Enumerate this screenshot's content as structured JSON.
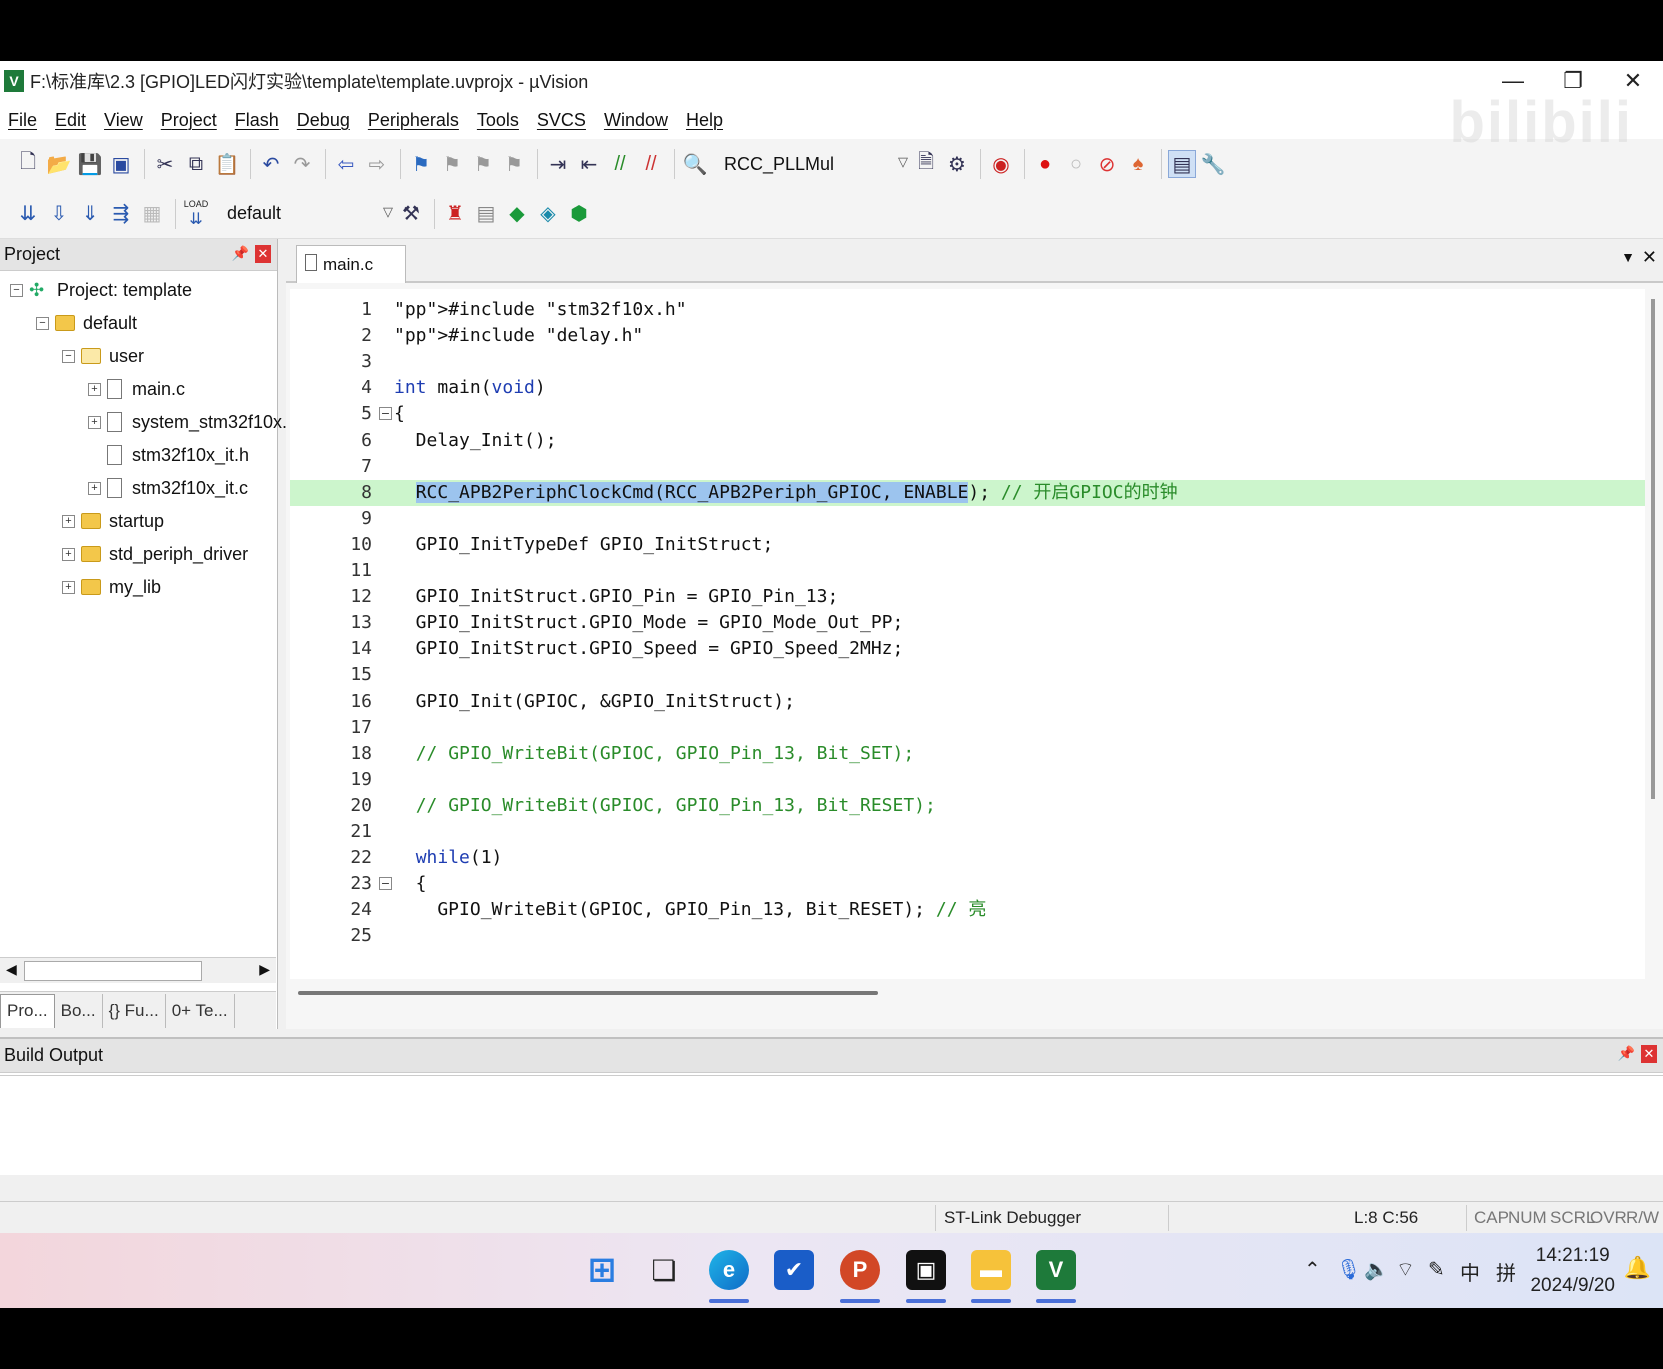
{
  "window": {
    "title": "F:\\标准库\\2.3 [GPIO]LED闪灯实验\\template\\template.uvprojx - µVision",
    "controls": {
      "minimize": "—",
      "restore": "❐",
      "close": "✕"
    }
  },
  "menu": [
    "File",
    "Edit",
    "View",
    "Project",
    "Flash",
    "Debug",
    "Peripherals",
    "Tools",
    "SVCS",
    "Window",
    "Help"
  ],
  "toolbar": {
    "find_combo_value": "RCC_PLLMul",
    "target_combo_value": "default",
    "load_label": "LOAD"
  },
  "project_panel": {
    "title": "Project",
    "tree": [
      {
        "label": "Project: template",
        "level": 0,
        "kind": "project",
        "expander": "−"
      },
      {
        "label": "default",
        "level": 1,
        "kind": "target",
        "expander": "−"
      },
      {
        "label": "user",
        "level": 2,
        "kind": "folder",
        "expander": "−"
      },
      {
        "label": "main.c",
        "level": 3,
        "kind": "file",
        "expander": "+"
      },
      {
        "label": "system_stm32f10x.c",
        "level": 3,
        "kind": "file",
        "expander": "+"
      },
      {
        "label": "stm32f10x_it.h",
        "level": 3,
        "kind": "file",
        "expander": ""
      },
      {
        "label": "stm32f10x_it.c",
        "level": 3,
        "kind": "file",
        "expander": "+"
      },
      {
        "label": "startup",
        "level": 2,
        "kind": "folder",
        "expander": "+"
      },
      {
        "label": "std_periph_driver",
        "level": 2,
        "kind": "folder",
        "expander": "+"
      },
      {
        "label": "my_lib",
        "level": 2,
        "kind": "folder",
        "expander": "+"
      }
    ],
    "tabs": [
      "Pro...",
      "Bo...",
      "{} Fu...",
      "0+ Te..."
    ]
  },
  "editor": {
    "active_tab": "main.c",
    "lines": [
      {
        "n": "1",
        "text": "#include \"stm32f10x.h\""
      },
      {
        "n": "2",
        "text": "#include \"delay.h\""
      },
      {
        "n": "3",
        "text": ""
      },
      {
        "n": "4",
        "text": "int main(void)"
      },
      {
        "n": "5",
        "text": "{"
      },
      {
        "n": "6",
        "text": "  Delay_Init();"
      },
      {
        "n": "7",
        "text": ""
      },
      {
        "n": "8",
        "text": "  RCC_APB2PeriphClockCmd(RCC_APB2Periph_GPIOC, ENABLE); // 开启GPIOC的时钟"
      },
      {
        "n": "9",
        "text": ""
      },
      {
        "n": "10",
        "text": "  GPIO_InitTypeDef GPIO_InitStruct;"
      },
      {
        "n": "11",
        "text": ""
      },
      {
        "n": "12",
        "text": "  GPIO_InitStruct.GPIO_Pin = GPIO_Pin_13;"
      },
      {
        "n": "13",
        "text": "  GPIO_InitStruct.GPIO_Mode = GPIO_Mode_Out_PP;"
      },
      {
        "n": "14",
        "text": "  GPIO_InitStruct.GPIO_Speed = GPIO_Speed_2MHz;"
      },
      {
        "n": "15",
        "text": ""
      },
      {
        "n": "16",
        "text": "  GPIO_Init(GPIOC, &GPIO_InitStruct);"
      },
      {
        "n": "17",
        "text": ""
      },
      {
        "n": "18",
        "text": "  // GPIO_WriteBit(GPIOC, GPIO_Pin_13, Bit_SET);"
      },
      {
        "n": "19",
        "text": ""
      },
      {
        "n": "20",
        "text": "  // GPIO_WriteBit(GPIOC, GPIO_Pin_13, Bit_RESET);"
      },
      {
        "n": "21",
        "text": ""
      },
      {
        "n": "22",
        "text": "  while(1)"
      },
      {
        "n": "23",
        "text": "  {"
      },
      {
        "n": "24",
        "text": "    GPIO_WriteBit(GPIOC, GPIO_Pin_13, Bit_RESET); // 亮"
      },
      {
        "n": "25",
        "text": ""
      }
    ],
    "highlighted_line": "8",
    "selected_text": "RCC_APB2PeriphClockCmd(RCC_APB2Periph_GPIOC, ENABLE",
    "keywords": [
      "int",
      "void",
      "while"
    ]
  },
  "build_output": {
    "title": "Build Output"
  },
  "status": {
    "debugger": "ST-Link Debugger",
    "position": "L:8 C:56",
    "indicators": [
      "CAP",
      "NUM",
      "SCRL",
      "OVR",
      "R/W"
    ]
  },
  "taskbar": {
    "time": "14:21:19",
    "date": "2024/9/20",
    "ime_lang": "中",
    "ime_mode": "拼"
  },
  "watermark": "bilibili",
  "colors": {
    "highlight_line": "#ccf5cc",
    "selection": "#9cc4ee",
    "keyword": "#1e3db2",
    "string": "#8a1a1a",
    "comment": "#2a8c2a",
    "marker": "#e4672a"
  }
}
